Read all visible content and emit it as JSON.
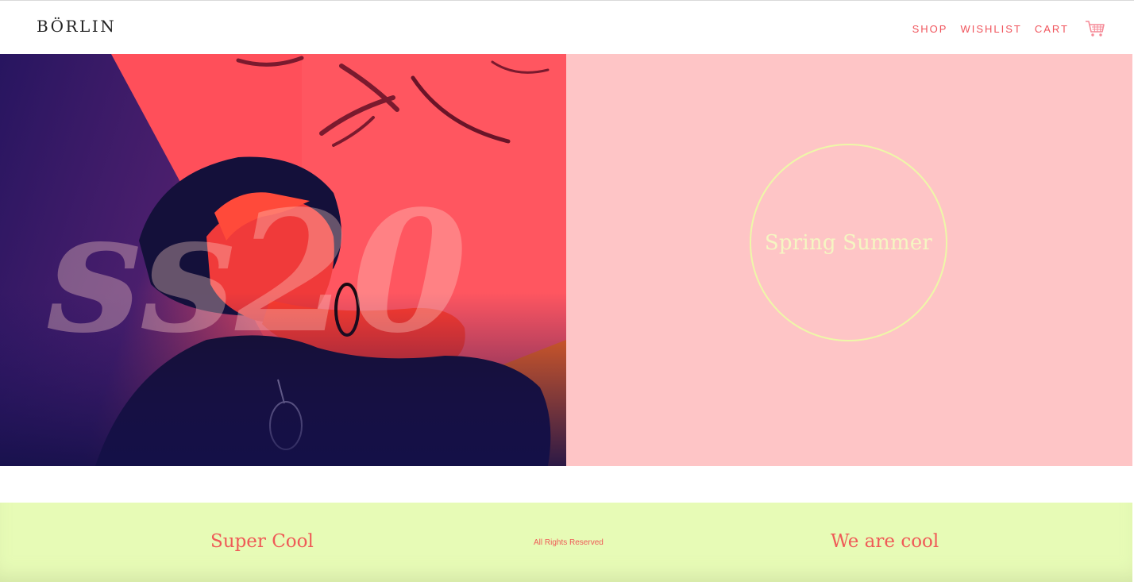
{
  "header": {
    "brand": "BÖRLIN",
    "nav": [
      "SHOP",
      "WISHLIST",
      "CART"
    ],
    "cart_icon": "shopping-cart-icon"
  },
  "hero": {
    "image_overlay_text": "ss20",
    "season_label": "Spring Summer"
  },
  "footer": {
    "left": "Super Cool",
    "center": "All Rights Reserved",
    "right": "We are cool"
  },
  "colors": {
    "accent": "#f0545c",
    "hero_panel": "#fec5c6",
    "circle": "#eef8a8",
    "footer_bg": "#e7fbb6",
    "image_base": "#ff4f5a",
    "image_shadow": "#1c1260"
  }
}
